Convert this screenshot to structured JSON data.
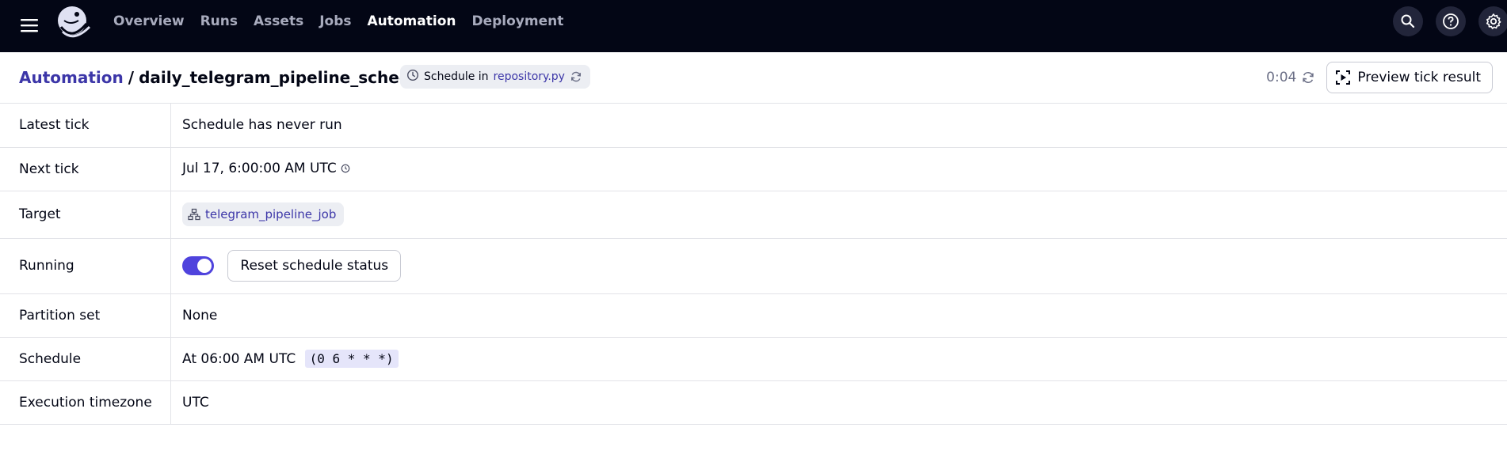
{
  "nav": {
    "items": [
      {
        "label": "Overview"
      },
      {
        "label": "Runs"
      },
      {
        "label": "Assets"
      },
      {
        "label": "Jobs"
      },
      {
        "label": "Automation"
      },
      {
        "label": "Deployment"
      }
    ],
    "active": "Automation",
    "icons": [
      "menu-icon",
      "dagster-logo",
      "search-icon",
      "help-icon",
      "settings-icon"
    ]
  },
  "header": {
    "breadcrumb_root": "Automation",
    "separator": "/",
    "schedule_name": "daily_telegram_pipeline_schedule",
    "tag_prefix": "Schedule in",
    "tag_repo": "repository.py",
    "timer": "0:04",
    "preview_button": "Preview tick result"
  },
  "details": {
    "latest_tick": {
      "label": "Latest tick",
      "value": "Schedule has never run"
    },
    "next_tick": {
      "label": "Next tick",
      "value": "Jul 17, 6:00:00 AM UTC"
    },
    "target": {
      "label": "Target",
      "value": "telegram_pipeline_job"
    },
    "running": {
      "label": "Running",
      "toggle_on": true,
      "reset_button": "Reset schedule status"
    },
    "partition_set": {
      "label": "Partition set",
      "value": "None"
    },
    "schedule": {
      "label": "Schedule",
      "value": "At 06:00 AM UTC",
      "cron": "(0 6 * * *)"
    },
    "timezone": {
      "label": "Execution timezone",
      "value": "UTC"
    }
  },
  "colors": {
    "topbar": "#030615",
    "accent": "#4f43dd",
    "link": "#3c36a8",
    "nav_inactive": "#a8abbd"
  }
}
